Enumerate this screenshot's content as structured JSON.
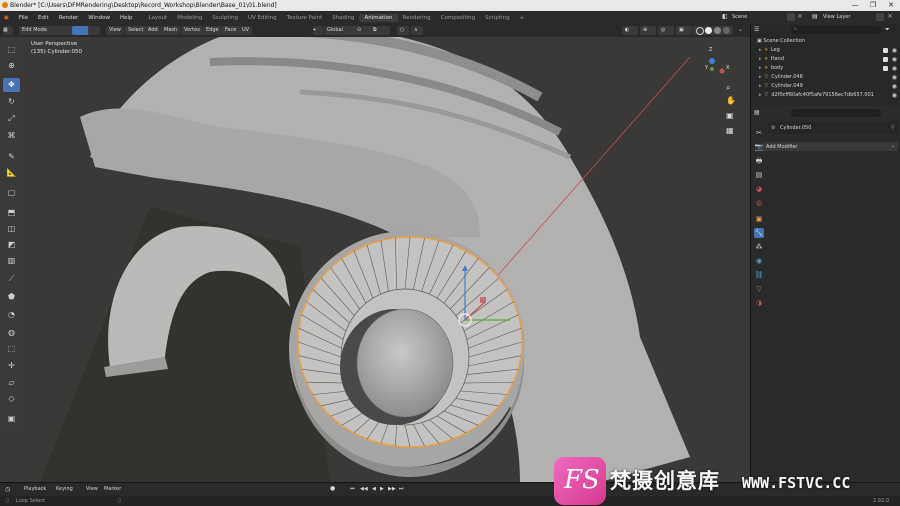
{
  "window": {
    "title": "Blender* [C:\\Users\\DFMRendering\\Desktop\\Record_Workshop\\Blender\\Base_01\\01.blend]",
    "controls": [
      "—",
      "❐",
      "✕"
    ]
  },
  "menu": {
    "items": [
      "File",
      "Edit",
      "Render",
      "Window",
      "Help"
    ],
    "workspaces": [
      "Layout",
      "Modeling",
      "Sculpting",
      "UV Editing",
      "Texture Paint",
      "Shading",
      "Animation",
      "Rendering",
      "Compositing",
      "Scripting"
    ],
    "active_workspace": "Animation",
    "add_tab": "+",
    "scene_label": "Scene",
    "view_layer_label": "View Layer"
  },
  "viewport_header": {
    "mode": "Edit Mode",
    "menus": [
      "View",
      "Select",
      "Add",
      "Mesh",
      "Vertex",
      "Edge",
      "Face",
      "UV"
    ],
    "orientation": "Global"
  },
  "viewport": {
    "overlay_line1": "User Perspective",
    "overlay_line2": "(135) Cylinder.050",
    "gizmo_axes": [
      "Z",
      "Y",
      "X"
    ]
  },
  "tools": [
    "select-box",
    "cursor",
    "move",
    "rotate",
    "scale",
    "transform",
    "annotate",
    "measure",
    "add-cube",
    "extrude",
    "inset",
    "bevel",
    "loop-cut",
    "knife",
    "poly-build",
    "spin",
    "smooth",
    "edge-slide",
    "shrink-fatten",
    "shear",
    "rip"
  ],
  "outliner": {
    "search_placeholder": "",
    "collection": "Scene Collection",
    "rows": [
      {
        "name": "Leg",
        "icon": "armature"
      },
      {
        "name": "Hand",
        "icon": "armature"
      },
      {
        "name": "body",
        "icon": "armature"
      },
      {
        "name": "Cylinder.048",
        "icon": "mesh"
      },
      {
        "name": "Cylinder.049",
        "icon": "mesh"
      },
      {
        "name": "d2f0cff60afc40f5afe79156ec7db657.001",
        "icon": "mesh"
      }
    ]
  },
  "properties": {
    "object_name": "Cylinder.050",
    "add_modifier": "Add Modifier",
    "tab_icons": [
      "tool",
      "render",
      "output",
      "view-layer",
      "scene",
      "world",
      "object",
      "modifier",
      "particles",
      "physics",
      "constraints",
      "data",
      "material",
      "texture"
    ]
  },
  "timeline": {
    "menus": [
      "Playback",
      "Keying",
      "View",
      "Marker"
    ],
    "transport": [
      "⏮",
      "◀◀",
      "◀",
      "▶",
      "▶▶",
      "⏭"
    ]
  },
  "status": {
    "left": "Loop Select",
    "version": "2.92.0"
  },
  "watermark": {
    "logo": "FS",
    "text": "梵摄创意库",
    "url": "WWW.FSTVC.CC"
  },
  "colors": {
    "accent": "#4772b3",
    "selection": "#e8a14a",
    "watermark": "#e050a8",
    "background": "#1d1d1d"
  }
}
